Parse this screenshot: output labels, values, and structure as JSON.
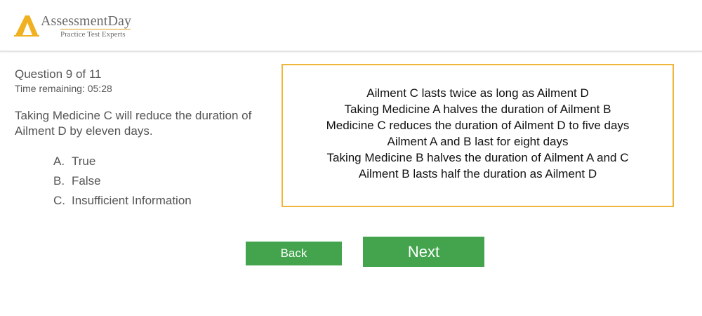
{
  "header": {
    "logo_name": "AssessmentDay",
    "logo_tagline": "Practice Test Experts",
    "logo_icon": "letter-a-logo-icon",
    "colors": {
      "logo_accent": "#f0b020",
      "divider": "#e3e3e3"
    }
  },
  "question": {
    "number_label": "Question 9 of 11",
    "time_label": "Time remaining: 05:28",
    "text": "Taking Medicine C will reduce the duration of Ailment D by eleven days.",
    "options": [
      {
        "letter": "A.",
        "label": "True"
      },
      {
        "letter": "B.",
        "label": "False"
      },
      {
        "letter": "C.",
        "label": "Insufficient Information"
      }
    ]
  },
  "passage": {
    "border_color": "#f0b63a",
    "lines": [
      "Ailment C lasts twice as long as Ailment D",
      "Taking Medicine A halves the duration of Ailment B",
      "Medicine C reduces the duration of Ailment D to five days",
      "Ailment A and B last for eight days",
      "Taking Medicine B halves the duration of Ailment A and C",
      "Ailment B lasts half the duration as Ailment D"
    ]
  },
  "navigation": {
    "back_label": "Back",
    "next_label": "Next",
    "button_color": "#43a44d"
  }
}
